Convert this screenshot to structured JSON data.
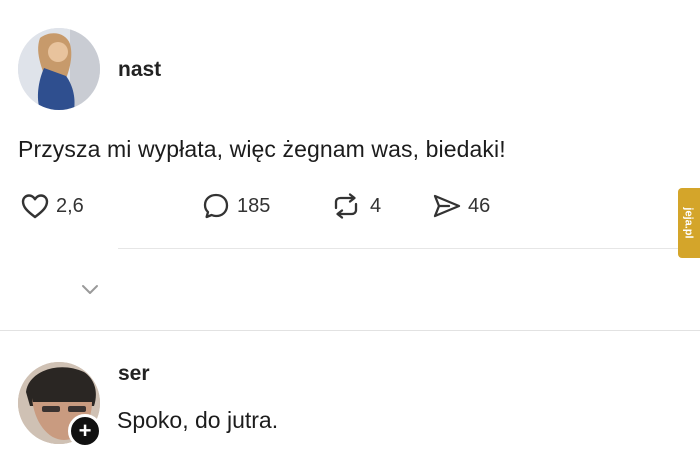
{
  "post": {
    "username": "nast",
    "text": "Przysza mi wypłata, więc żegnam was, biedaki!",
    "avatar_icon": "user-avatar-photo",
    "likes": "2,6",
    "replies": "185",
    "reposts": "4",
    "shares": "46",
    "expand_icon": "chevron-down-icon"
  },
  "reply": {
    "username": "ser",
    "text": "Spoko, do jutra.",
    "avatar_icon": "user-avatar-photo",
    "follow_badge": "+"
  },
  "watermark": "jeja.pl",
  "colors": {
    "background": "#ffffff",
    "text": "#1a1a1a",
    "divider": "#e6e6e6",
    "badge": "#111111",
    "watermark": "#d4a52a"
  }
}
